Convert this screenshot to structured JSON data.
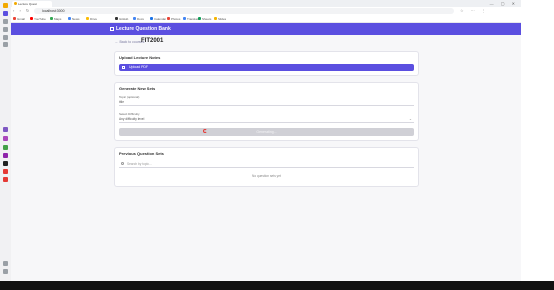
{
  "browser": {
    "tab_title": "Lecture Quest",
    "url": "localhost:3000",
    "window_controls": "— ▢ ✕",
    "nav_buttons": "‹ › ↻",
    "ext_icons": "☆ ⋯ ⋮",
    "bookmarks": [
      {
        "label": "Gmail",
        "color": "#ea4335"
      },
      {
        "label": "YouTube",
        "color": "#ff0000"
      },
      {
        "label": "Maps",
        "color": "#34a853"
      },
      {
        "label": "News",
        "color": "#4285f4"
      },
      {
        "label": "Drive",
        "color": "#fbbc05"
      },
      {
        "label": "GitHub",
        "color": "#333333"
      },
      {
        "label": "Docs",
        "color": "#4285f4"
      },
      {
        "label": "Calendar",
        "color": "#1a73e8"
      },
      {
        "label": "Photos",
        "color": "#ea4335"
      },
      {
        "label": "Translate",
        "color": "#4285f4"
      },
      {
        "label": "Sheets",
        "color": "#0f9d58"
      },
      {
        "label": "Slides",
        "color": "#f4b400"
      }
    ]
  },
  "app": {
    "title": "Lecture Question Bank",
    "accent": "#5b4fe0"
  },
  "page": {
    "back_link": "← Back to courses",
    "course_code": "FIT2001"
  },
  "upload_card": {
    "title": "Upload Lecture Notes",
    "button_label": "Upload PDF"
  },
  "generate_card": {
    "title": "Generate New Sets",
    "topic_label": "Topic (optional)",
    "topic_value": "title",
    "difficulty_label": "Select Difficulty",
    "difficulty_value": "Any difficulty level",
    "generate_button": "Generating..."
  },
  "questions_card": {
    "title": "Previous Question Sets",
    "search_placeholder": "Search by topic...",
    "empty_message": "No question sets yet"
  }
}
